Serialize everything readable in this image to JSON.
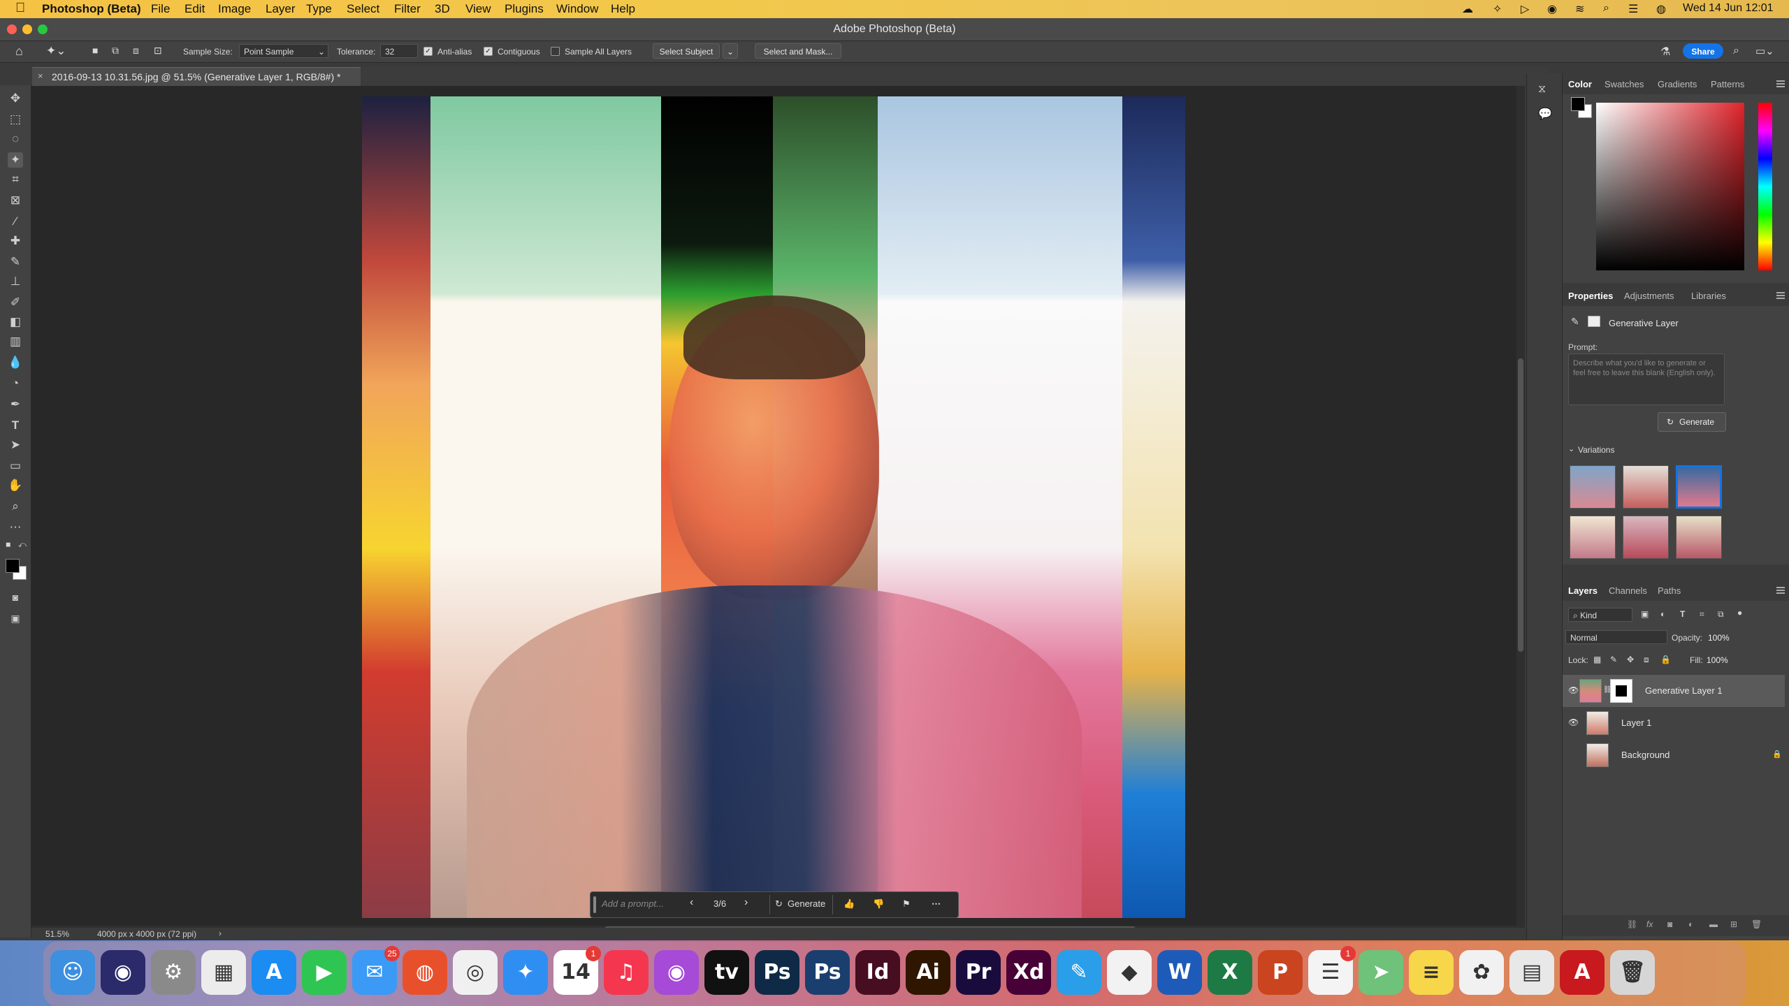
{
  "menubar": {
    "app_name": "Photoshop (Beta)",
    "items": [
      "File",
      "Edit",
      "Image",
      "Layer",
      "Type",
      "Select",
      "Filter",
      "3D",
      "View",
      "Plugins",
      "Window",
      "Help"
    ],
    "clock": "Wed 14 Jun  12:01"
  },
  "window": {
    "title": "Adobe Photoshop (Beta)"
  },
  "options": {
    "sample_size_label": "Sample Size:",
    "sample_size_value": "Point Sample",
    "tolerance_label": "Tolerance:",
    "tolerance_value": "32",
    "anti_alias_label": "Anti-alias",
    "anti_alias_checked": true,
    "contiguous_label": "Contiguous",
    "contiguous_checked": true,
    "sample_all_layers_label": "Sample All Layers",
    "sample_all_layers_checked": false,
    "select_subject": "Select Subject",
    "select_and_mask": "Select and Mask...",
    "share": "Share"
  },
  "document": {
    "tab_title": "2016-09-13 10.31.56.jpg @ 51.5% (Generative Layer 1, RGB/8#) *",
    "zoom": "51.5%",
    "dimensions": "4000 px x 4000 px (72 ppi)"
  },
  "genbar": {
    "prompt_placeholder": "Add a prompt...",
    "counter": "3/6",
    "generate": "Generate"
  },
  "color_panel": {
    "tabs": [
      "Color",
      "Swatches",
      "Gradients",
      "Patterns"
    ],
    "active_tab": "Color",
    "foreground": "#000000",
    "background": "#ffffff",
    "hue": "#e0242b"
  },
  "properties_panel": {
    "tabs": [
      "Properties",
      "Adjustments",
      "Libraries"
    ],
    "layer_type": "Generative Layer",
    "prompt_label": "Prompt:",
    "prompt_placeholder": "Describe what you'd like to generate or feel free to leave this blank (English only).",
    "generate": "Generate",
    "variations_label": "Variations",
    "selected_variation": 3
  },
  "layers_panel": {
    "tabs": [
      "Layers",
      "Channels",
      "Paths"
    ],
    "filter_kind": "Kind",
    "blend_mode": "Normal",
    "opacity_label": "Opacity:",
    "opacity_value": "100%",
    "lock_label": "Lock:",
    "fill_label": "Fill:",
    "fill_value": "100%",
    "layers": [
      {
        "name": "Generative Layer 1",
        "visible": true,
        "selected": true,
        "locked": false
      },
      {
        "name": "Layer 1",
        "visible": true,
        "selected": false,
        "locked": false
      },
      {
        "name": "Background",
        "visible": false,
        "selected": false,
        "locked": true
      }
    ]
  },
  "dock": {
    "apps": [
      {
        "name": "Finder",
        "icon": "finder-icon",
        "color": "#3d8fe0",
        "glyph": "☺"
      },
      {
        "name": "Siri",
        "icon": "siri-icon",
        "color": "#2b2b6b",
        "glyph": "◉"
      },
      {
        "name": "System Settings",
        "icon": "settings-icon",
        "color": "#8a8a8a",
        "glyph": "⚙"
      },
      {
        "name": "Launchpad",
        "icon": "launchpad-icon",
        "color": "#ececec",
        "glyph": "▦"
      },
      {
        "name": "App Store",
        "icon": "appstore-icon",
        "color": "#1b8cf2",
        "glyph": "A"
      },
      {
        "name": "FaceTime",
        "icon": "facetime-icon",
        "color": "#2fc553",
        "glyph": "▶"
      },
      {
        "name": "Mail",
        "icon": "mail-icon",
        "color": "#3a9af5",
        "glyph": "✉",
        "badge": "25"
      },
      {
        "name": "Firefox",
        "icon": "firefox-icon",
        "color": "#e8502c",
        "glyph": "◍"
      },
      {
        "name": "Chrome",
        "icon": "chrome-icon",
        "color": "#f0f0f0",
        "glyph": "◎"
      },
      {
        "name": "Safari",
        "icon": "safari-icon",
        "color": "#2f8ef2",
        "glyph": "✦"
      },
      {
        "name": "Calendar",
        "icon": "calendar-icon",
        "color": "#ffffff",
        "glyph": "14",
        "badge": "1"
      },
      {
        "name": "Music",
        "icon": "music-icon",
        "color": "#f5364f",
        "glyph": "♫"
      },
      {
        "name": "Podcasts",
        "icon": "podcasts-icon",
        "color": "#a64ad8",
        "glyph": "◉"
      },
      {
        "name": "Apple TV",
        "icon": "appletv-icon",
        "color": "#111111",
        "glyph": "tv"
      },
      {
        "name": "Photoshop",
        "icon": "photoshop-icon",
        "color": "#0f2a46",
        "glyph": "Ps"
      },
      {
        "name": "Photoshop (Beta)",
        "icon": "photoshop-beta-icon",
        "color": "#1a3f6e",
        "glyph": "Ps"
      },
      {
        "name": "InDesign",
        "icon": "indesign-icon",
        "color": "#470d20",
        "glyph": "Id"
      },
      {
        "name": "Illustrator",
        "icon": "illustrator-icon",
        "color": "#2e1600",
        "glyph": "Ai"
      },
      {
        "name": "Premiere Pro",
        "icon": "premiere-icon",
        "color": "#1a0b3d",
        "glyph": "Pr"
      },
      {
        "name": "Adobe XD",
        "icon": "xd-icon",
        "color": "#470137",
        "glyph": "Xd"
      },
      {
        "name": "Pencil",
        "icon": "pencil-icon",
        "color": "#2a9ee8",
        "glyph": "✎"
      },
      {
        "name": "Vectornator",
        "icon": "vector-icon",
        "color": "#f2f2f2",
        "glyph": "◆"
      },
      {
        "name": "Word",
        "icon": "word-icon",
        "color": "#1e5bb8",
        "glyph": "W"
      },
      {
        "name": "Excel",
        "icon": "excel-icon",
        "color": "#1d7a45",
        "glyph": "X"
      },
      {
        "name": "PowerPoint",
        "icon": "powerpoint-icon",
        "color": "#c9441f",
        "glyph": "P"
      },
      {
        "name": "Reminders",
        "icon": "reminders-icon",
        "color": "#f4f4f4",
        "glyph": "☰",
        "badge": "1"
      },
      {
        "name": "Maps",
        "icon": "maps-icon",
        "color": "#6fc27a",
        "glyph": "➤"
      },
      {
        "name": "Notes",
        "icon": "notes-icon",
        "color": "#f7d64a",
        "glyph": "≡"
      },
      {
        "name": "Photos",
        "icon": "photos-icon",
        "color": "#f1f1f1",
        "glyph": "✿"
      },
      {
        "name": "Preview",
        "icon": "preview-icon",
        "color": "#e8e8e8",
        "glyph": "▤"
      },
      {
        "name": "Acrobat",
        "icon": "acrobat-icon",
        "color": "#c7191e",
        "glyph": "A"
      },
      {
        "name": "Trash",
        "icon": "trash-icon",
        "color": "#d6d6d6",
        "glyph": "🗑"
      }
    ]
  }
}
